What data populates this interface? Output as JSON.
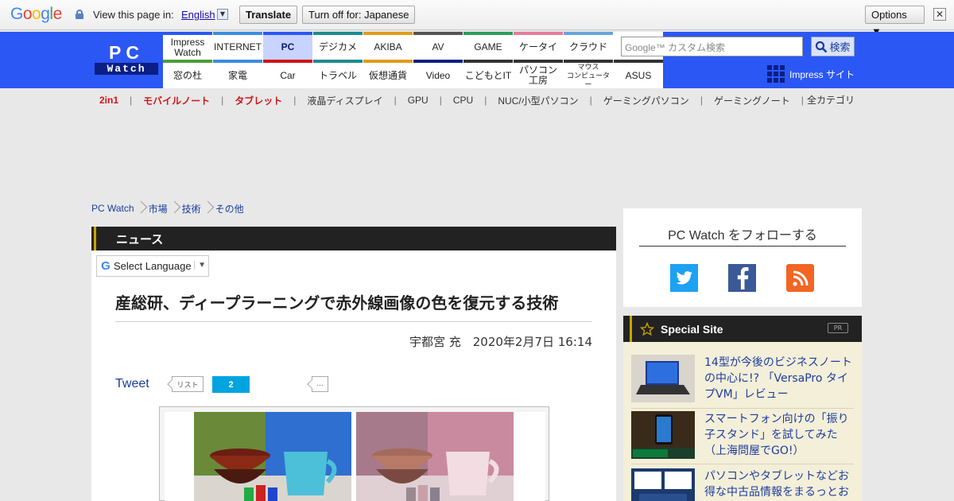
{
  "google_bar": {
    "logo_letters": [
      {
        "ch": "G",
        "color": "#4285f4"
      },
      {
        "ch": "o",
        "color": "#ea4335"
      },
      {
        "ch": "o",
        "color": "#fbbc05"
      },
      {
        "ch": "g",
        "color": "#4285f4"
      },
      {
        "ch": "l",
        "color": "#34a853"
      },
      {
        "ch": "e",
        "color": "#ea4335"
      }
    ],
    "view_text": "View this page in:",
    "language": "English",
    "translate_label": "Translate",
    "turn_off_label": "Turn off for: Japanese",
    "options_label": "Options ▼",
    "close_glyph": "✕"
  },
  "header": {
    "logo_top": "PC",
    "logo_bottom": "Watch",
    "nav_top": [
      {
        "label": "Impress\nWatch",
        "color": "#2b57f5"
      },
      {
        "label": "INTERNET",
        "color": "#3a8de0"
      },
      {
        "label": "PC",
        "color": "#2b57f5",
        "active": true
      },
      {
        "label": "デジカメ",
        "color": "#1c8c8c"
      },
      {
        "label": "AKIBA",
        "color": "#e39b1b"
      },
      {
        "label": "AV",
        "color": "#555555"
      },
      {
        "label": "GAME",
        "color": "#2e9e5a"
      },
      {
        "label": "ケータイ",
        "color": "#e87a9a"
      },
      {
        "label": "クラウド",
        "color": "#6aa4dc"
      },
      {
        "label": "",
        "color": "#ffffff"
      }
    ],
    "nav_bottom": [
      {
        "label": "窓の杜",
        "color": "#4a9e3a"
      },
      {
        "label": "家電",
        "color": "#3a8de0"
      },
      {
        "label": "Car",
        "color": "#d0141a"
      },
      {
        "label": "トラベル",
        "color": "#1c8c8c"
      },
      {
        "label": "仮想通貨",
        "color": "#e39b1b"
      },
      {
        "label": "Video",
        "color": "#0b1f84"
      },
      {
        "label": "こどもとIT",
        "color": "#333333"
      },
      {
        "label": "パソコン\n工房",
        "color": "#333333"
      },
      {
        "label": "マウス\nコンピューター",
        "color": "#333333",
        "small": true
      },
      {
        "label": "ASUS",
        "color": "#333333"
      }
    ],
    "search_placeholder": "Google™ カスタム検索",
    "search_button": "検索",
    "impress_site": "Impress サイト"
  },
  "categories": [
    {
      "label": "2in1",
      "red": true
    },
    {
      "label": "モバイルノート",
      "red": true
    },
    {
      "label": "タブレット",
      "red": true
    },
    {
      "label": "液晶ディスプレイ"
    },
    {
      "label": "GPU"
    },
    {
      "label": "CPU"
    },
    {
      "label": "NUC/小型パソコン"
    },
    {
      "label": "ゲーミングパソコン"
    },
    {
      "label": "ゲーミングノート"
    }
  ],
  "all_categories": "全カテゴリ",
  "breadcrumb": [
    "PC Watch",
    "市場",
    "技術",
    "その他"
  ],
  "article": {
    "section": "ニュース",
    "select_language": "Select Language",
    "title": "産総研、ディープラーニングで赤外線画像の色を復元する技術",
    "byline": "宇都宮 充　2020年2月7日 16:14",
    "tweet": "Tweet",
    "list_label": "リスト",
    "hatena_count": "2",
    "more_label": "..."
  },
  "sidebar": {
    "follow_title": "PC Watch をフォローする",
    "social": [
      "twitter-icon",
      "facebook-icon",
      "rss-icon"
    ],
    "special_title": "Special Site",
    "pr_label": "PR",
    "items": [
      {
        "text": "14型が今後のビジネスノートの中心に!? 「VersaPro タイプVM」レビュー"
      },
      {
        "text": "スマートフォン向けの「振り子スタンド」を試してみた（上海問屋でGO!）"
      },
      {
        "text": "パソコンやタブレットなどお得な中古品情報をまるっとお"
      }
    ]
  }
}
